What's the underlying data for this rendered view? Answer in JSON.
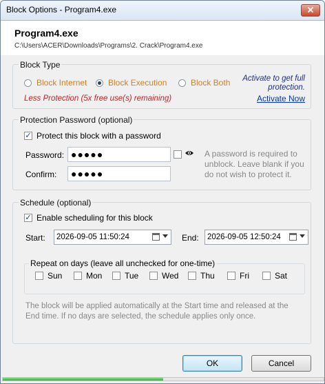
{
  "window": {
    "title": "Block Options - Program4.exe",
    "close_glyph": "✕"
  },
  "header": {
    "name": "Program4.exe",
    "path": "C:\\Users\\ACER\\Downloads\\Programs\\2. Crack\\Program4.exe"
  },
  "block_type": {
    "legend": "Block Type",
    "options": [
      {
        "label": "Block Internet",
        "selected": false
      },
      {
        "label": "Block Execution",
        "selected": true
      },
      {
        "label": "Block Both",
        "selected": false
      }
    ],
    "warning": "Less Protection (5x free use(s) remaining)",
    "promo_text_1": "Activate to get full",
    "promo_text_2": "protection.",
    "activate_link": "Activate Now",
    "colors": {
      "option_text": "#d08020",
      "warning": "#d12020",
      "promo": "#1c2f8a",
      "link": "#0033cc"
    }
  },
  "protection": {
    "legend": "Protection Password (optional)",
    "checkbox_label": "Protect this block with a password",
    "checked": true,
    "password_label": "Password:",
    "password_value": "●●●●●",
    "confirm_label": "Confirm:",
    "confirm_value": "●●●●●",
    "show_checked": false,
    "help_1": "A password is required to",
    "help_2": "unblock. Leave blank if you",
    "help_3": "do not wish to protect it."
  },
  "schedule": {
    "legend": "Schedule (optional)",
    "checkbox_label": "Enable scheduling for this block",
    "checked": true,
    "start_label": "Start:",
    "start_value": "2026-09-05 11:50:24",
    "end_label": "End:",
    "end_value": "2026-09-05 12:50:24",
    "repeat_legend": "Repeat on days (leave all unchecked for one-time)",
    "days": [
      {
        "label": "Sun",
        "checked": false
      },
      {
        "label": "Mon",
        "checked": false
      },
      {
        "label": "Tue",
        "checked": false
      },
      {
        "label": "Wed",
        "checked": false
      },
      {
        "label": "Thu",
        "checked": false
      },
      {
        "label": "Fri",
        "checked": false
      },
      {
        "label": "Sat",
        "checked": false
      }
    ],
    "note_1": "The block will be applied automatically at the Start time and released at the",
    "note_2": "End time. If no days are selected, the schedule applies only once."
  },
  "buttons": {
    "ok": "OK",
    "cancel": "Cancel"
  },
  "status": {
    "progress_fraction": 0.5
  },
  "icons": {
    "close": "close-icon",
    "eye": "eye-icon",
    "calendar": "calendar-icon",
    "dropdown": "chevron-down-icon"
  }
}
